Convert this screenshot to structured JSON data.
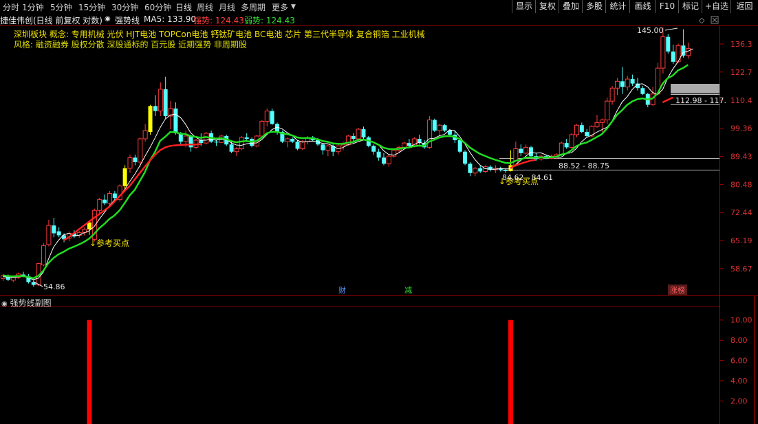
{
  "topbar": {
    "tabs": [
      "分时",
      "1分钟",
      "5分钟",
      "15分钟",
      "30分钟",
      "60分钟",
      "日线",
      "周线",
      "月线",
      "多周期",
      "更多"
    ],
    "buttons": [
      "显示",
      "复权",
      "叠加",
      "多股",
      "统计",
      "画线",
      "F10",
      "标记",
      "+自选",
      "返回"
    ]
  },
  "info": {
    "title": "捷佳伟创(日线 前复权 对数)",
    "indicator": "强势线",
    "ma5": "MA5: 133.90",
    "strong": "强势: 124.43",
    "weak": "弱势: 124.43"
  },
  "tags": {
    "line1": "深圳板块  概念: 专用机械   光伏 HJT电池 TOPCon电池 钙钛矿电池 BC电池 芯片 第三代半导体 复合铜箔 工业机械",
    "line2": "风格: 融资融券 股权分散 深股通标的 百元股 近期强势 非周期股"
  },
  "annotations": {
    "high": "145.00",
    "low": "54.86",
    "buy1": "参考买点",
    "buy2": "参考买点",
    "range1": "88.52 - 88.75",
    "range2": "84.62 - 84.61",
    "range3": "112.98 - 117.",
    "event1": "财",
    "event2": "减",
    "event3": "涨榜"
  },
  "main_axis": [
    "136.3",
    "122.7",
    "110.4",
    "99.36",
    "89.43",
    "80.48",
    "72.44",
    "65.19",
    "58.67"
  ],
  "sub": {
    "title": "强势线副图",
    "axis": [
      "10.00",
      "8.00",
      "6.00",
      "4.00",
      "2.00"
    ]
  },
  "colors": {
    "up": "#ff3c3c",
    "down": "#54ffff",
    "signal": "#ffff00",
    "strong_line": "#ff2020",
    "weak_line": "#20dd20",
    "ma5": "#ffffff"
  },
  "chart_data": {
    "type": "candlestick",
    "scale": "log",
    "ylim": [
      56,
      145
    ],
    "yticks": [
      136.3,
      122.7,
      110.4,
      99.36,
      89.43,
      80.48,
      72.44,
      65.19,
      58.67
    ],
    "candles": [
      [
        56.5,
        57.5,
        56.0,
        57.2
      ],
      [
        57.2,
        57.4,
        56.0,
        56.3
      ],
      [
        56.2,
        57.0,
        55.8,
        56.8
      ],
      [
        56.8,
        57.8,
        56.5,
        57.5
      ],
      [
        57.4,
        58.0,
        56.8,
        57.0
      ],
      [
        57.0,
        57.5,
        55.5,
        55.8
      ],
      [
        55.8,
        56.2,
        54.86,
        55.2
      ],
      [
        55.2,
        60.0,
        55.0,
        59.8
      ],
      [
        59.5,
        64.5,
        59.2,
        64.0
      ],
      [
        64.2,
        70.5,
        63.8,
        69.0
      ],
      [
        69.0,
        71.0,
        66.0,
        67.0
      ],
      [
        67.5,
        68.5,
        66.0,
        66.5
      ],
      [
        66.5,
        67.0,
        64.8,
        65.5
      ],
      [
        65.8,
        67.5,
        65.0,
        67.0
      ],
      [
        67.0,
        67.8,
        65.8,
        66.2
      ],
      [
        66.5,
        67.6,
        65.9,
        67.2
      ],
      [
        67.2,
        68.5,
        66.5,
        68.0
      ],
      [
        68.0,
        70.3,
        66.6,
        69.8
      ],
      [
        65.5,
        73.5,
        65.0,
        73.0
      ],
      [
        73.0,
        76.5,
        72.0,
        76.0
      ],
      [
        76.0,
        77.5,
        74.5,
        75.0
      ],
      [
        75.0,
        78.5,
        74.0,
        77.8
      ],
      [
        77.8,
        78.5,
        76.0,
        76.5
      ],
      [
        76.0,
        80.5,
        75.5,
        80.0
      ],
      [
        80.0,
        86.5,
        79.0,
        85.5
      ],
      [
        85.5,
        90.0,
        84.0,
        89.0
      ],
      [
        89.0,
        90.0,
        86.5,
        87.5
      ],
      [
        87.5,
        96.0,
        86.0,
        95.5
      ],
      [
        95.5,
        101.0,
        94.5,
        98.5
      ],
      [
        98.0,
        108.5,
        97.0,
        108.0
      ],
      [
        108.0,
        112.5,
        104.0,
        106.0
      ],
      [
        106.0,
        118.0,
        104.0,
        115.0
      ],
      [
        115.0,
        120.5,
        103.0,
        104.0
      ],
      [
        104.0,
        110.0,
        99.0,
        107.0
      ],
      [
        107.0,
        109.5,
        97.0,
        97.5
      ],
      [
        97.5,
        98.0,
        93.0,
        94.5
      ],
      [
        94.5,
        98.5,
        92.5,
        96.5
      ],
      [
        96.5,
        97.0,
        91.0,
        92.5
      ],
      [
        92.5,
        95.5,
        92.0,
        95.0
      ],
      [
        95.0,
        97.5,
        93.0,
        94.0
      ],
      [
        94.0,
        98.0,
        93.5,
        97.5
      ],
      [
        97.5,
        98.5,
        94.0,
        94.5
      ],
      [
        94.5,
        95.0,
        93.0,
        94.2
      ],
      [
        94.2,
        97.0,
        94.0,
        96.5
      ],
      [
        96.5,
        97.0,
        93.0,
        93.5
      ],
      [
        93.5,
        94.5,
        90.5,
        91.0
      ],
      [
        91.0,
        92.5,
        89.5,
        92.0
      ],
      [
        92.0,
        96.5,
        91.5,
        96.0
      ],
      [
        96.0,
        97.5,
        94.5,
        95.5
      ],
      [
        95.5,
        96.0,
        92.5,
        93.0
      ],
      [
        93.0,
        97.0,
        92.5,
        96.5
      ],
      [
        96.5,
        102.5,
        96.0,
        102.0
      ],
      [
        102.0,
        107.0,
        100.0,
        106.0
      ],
      [
        106.0,
        107.0,
        100.5,
        101.0
      ],
      [
        101.0,
        101.5,
        97.0,
        98.0
      ],
      [
        98.0,
        98.5,
        94.0,
        94.5
      ],
      [
        94.5,
        96.0,
        92.5,
        95.5
      ],
      [
        95.5,
        96.0,
        94.0,
        94.5
      ],
      [
        94.5,
        95.0,
        91.5,
        92.0
      ],
      [
        92.0,
        95.0,
        91.5,
        94.5
      ],
      [
        94.5,
        96.5,
        93.5,
        96.0
      ],
      [
        96.0,
        96.5,
        94.5,
        95.0
      ],
      [
        95.0,
        95.8,
        93.0,
        93.5
      ],
      [
        93.5,
        94.0,
        90.0,
        91.5
      ],
      [
        91.5,
        93.5,
        89.5,
        93.0
      ],
      [
        93.0,
        93.5,
        89.5,
        91.0
      ],
      [
        91.0,
        93.5,
        90.0,
        93.0
      ],
      [
        93.0,
        94.5,
        91.5,
        93.5
      ],
      [
        93.5,
        97.0,
        93.0,
        96.5
      ],
      [
        96.5,
        97.5,
        94.5,
        95.5
      ],
      [
        95.5,
        99.5,
        95.0,
        99.0
      ],
      [
        99.0,
        100.0,
        95.5,
        96.0
      ],
      [
        96.0,
        96.5,
        92.5,
        93.0
      ],
      [
        93.0,
        93.5,
        90.0,
        91.0
      ],
      [
        91.0,
        92.0,
        88.0,
        89.0
      ],
      [
        89.0,
        90.5,
        86.5,
        87.0
      ],
      [
        87.0,
        90.0,
        86.0,
        89.5
      ],
      [
        89.5,
        92.0,
        89.0,
        91.5
      ],
      [
        91.5,
        93.0,
        90.5,
        92.5
      ],
      [
        92.5,
        94.5,
        92.0,
        94.0
      ],
      [
        94.0,
        95.5,
        92.5,
        93.0
      ],
      [
        93.0,
        96.0,
        92.5,
        95.5
      ],
      [
        95.5,
        97.0,
        93.5,
        94.0
      ],
      [
        94.0,
        95.0,
        92.0,
        92.5
      ],
      [
        92.5,
        104.0,
        92.0,
        102.5
      ],
      [
        102.5,
        103.0,
        98.0,
        98.5
      ],
      [
        98.5,
        101.0,
        96.5,
        100.5
      ],
      [
        100.5,
        101.0,
        98.0,
        98.5
      ],
      [
        98.5,
        99.0,
        96.5,
        97.0
      ],
      [
        97.0,
        98.5,
        94.0,
        95.0
      ],
      [
        95.0,
        95.5,
        90.5,
        91.0
      ],
      [
        91.0,
        91.5,
        86.5,
        87.0
      ],
      [
        87.0,
        87.5,
        83.0,
        84.0
      ],
      [
        84.0,
        86.0,
        83.0,
        85.5
      ],
      [
        85.5,
        86.5,
        84.0,
        84.5
      ],
      [
        84.5,
        86.5,
        84.0,
        86.0
      ],
      [
        86.0,
        86.5,
        84.5,
        85.0
      ],
      [
        85.0,
        86.5,
        84.0,
        85.5
      ],
      [
        85.5,
        86.0,
        84.5,
        85.0
      ],
      [
        85.0,
        85.5,
        84.0,
        84.62
      ],
      [
        84.62,
        91.5,
        84.5,
        86.5
      ],
      [
        86.5,
        94.5,
        86.0,
        92.0
      ],
      [
        92.0,
        93.5,
        89.5,
        90.5
      ],
      [
        90.5,
        93.5,
        90.0,
        92.5
      ],
      [
        92.5,
        93.0,
        89.0,
        89.5
      ],
      [
        89.5,
        90.5,
        88.0,
        88.5
      ],
      [
        88.5,
        90.0,
        88.0,
        89.5
      ],
      [
        89.5,
        90.0,
        88.52,
        88.75
      ],
      [
        88.75,
        90.0,
        88.5,
        89.5
      ],
      [
        89.5,
        90.5,
        88.5,
        90.0
      ],
      [
        90.0,
        94.5,
        89.5,
        94.0
      ],
      [
        94.0,
        95.5,
        92.0,
        92.5
      ],
      [
        92.5,
        97.5,
        92.0,
        97.0
      ],
      [
        97.0,
        101.0,
        96.0,
        100.5
      ],
      [
        100.5,
        101.5,
        97.5,
        98.0
      ],
      [
        98.0,
        99.0,
        96.0,
        96.5
      ],
      [
        96.5,
        100.5,
        96.0,
        100.0
      ],
      [
        100.0,
        104.5,
        99.5,
        101.5
      ],
      [
        101.5,
        103.0,
        98.0,
        102.5
      ],
      [
        102.5,
        111.5,
        101.0,
        110.0
      ],
      [
        110.0,
        116.5,
        108.5,
        115.5
      ],
      [
        115.5,
        120.0,
        112.5,
        118.5
      ],
      [
        118.5,
        125.0,
        113.0,
        116.0
      ],
      [
        116.0,
        121.0,
        114.5,
        119.5
      ],
      [
        119.5,
        121.5,
        116.5,
        117.5
      ],
      [
        117.5,
        120.0,
        114.5,
        115.5
      ],
      [
        115.5,
        116.5,
        112.5,
        113.0
      ],
      [
        113.0,
        113.5,
        107.5,
        108.5
      ],
      [
        108.5,
        116.0,
        108.0,
        112.98
      ],
      [
        112.98,
        127.0,
        112.5,
        124.5
      ],
      [
        124.5,
        145.0,
        122.0,
        140.0
      ],
      [
        140.0,
        141.5,
        131.5,
        132.5
      ],
      [
        132.5,
        136.0,
        126.5,
        127.5
      ],
      [
        127.5,
        136.5,
        127.0,
        135.5
      ],
      [
        135.5,
        144.0,
        129.5,
        130.5
      ],
      [
        130.5,
        137.0,
        129.0,
        134.0
      ]
    ],
    "ma5": [
      56.9,
      56.9,
      56.8,
      56.9,
      57.0,
      56.7,
      56.3,
      56.6,
      57.9,
      60.8,
      63.6,
      65.3,
      66.6,
      67.0,
      66.4,
      66.5,
      67.1,
      67.6,
      68.7,
      70.6,
      72.4,
      74.3,
      75.9,
      77.0,
      78.9,
      81.3,
      83.6,
      86.3,
      89.4,
      92.4,
      95.8,
      99.6,
      102.8,
      104.4,
      104.7,
      103.5,
      100.9,
      97.7,
      96.1,
      95.0,
      95.0,
      95.3,
      95.0,
      95.3,
      95.2,
      94.1,
      93.3,
      93.2,
      93.7,
      94.0,
      94.0,
      95.2,
      97.0,
      98.8,
      99.8,
      99.2,
      97.8,
      96.7,
      95.0,
      94.3,
      94.5,
      94.7,
      94.4,
      93.9,
      93.8,
      93.0,
      92.0,
      92.4,
      93.4,
      93.8,
      94.5,
      95.0,
      95.0,
      94.4,
      93.4,
      91.4,
      90.1,
      89.8,
      90.6,
      91.8,
      92.6,
      93.4,
      94.3,
      93.8,
      95.5,
      95.7,
      96.6,
      97.1,
      98.7,
      98.5,
      96.4,
      93.8,
      90.9,
      88.4,
      86.6,
      85.4,
      85.2,
      85.2,
      85.4,
      85.3,
      85.3,
      86.7,
      88.0,
      89.4,
      90.8,
      90.5,
      90.6,
      89.9,
      89.3,
      89.1,
      89.1,
      90.4,
      90.6,
      92.1,
      94.4,
      96.0,
      96.8,
      97.9,
      98.8,
      99.7,
      102.0,
      106.0,
      109.6,
      111.8,
      114.9,
      117.1,
      117.4,
      116.1,
      113.7,
      112.8,
      114.9,
      120.0,
      124.1,
      127.4,
      131.9,
      132.7,
      133.9
    ],
    "strong_line": {
      "start": 12,
      "end": 39,
      "values": [
        65.3,
        66.0,
        67.0,
        68.0,
        69.0,
        70.0,
        71.0,
        72.0,
        73.0,
        74.0,
        75.5,
        77.0,
        78.5,
        80.0,
        82.0,
        84.0,
        86.0,
        88.0,
        90.0,
        91.5,
        92.5,
        93.0,
        93.2,
        93.3,
        93.4,
        93.5,
        93.5,
        93.6
      ]
    },
    "weak_line": {
      "start": 0,
      "end": 139
    },
    "signals": [
      17,
      24,
      29,
      100
    ],
    "sub_bars": [
      17,
      100
    ],
    "sub_ylim": [
      0,
      11
    ]
  }
}
